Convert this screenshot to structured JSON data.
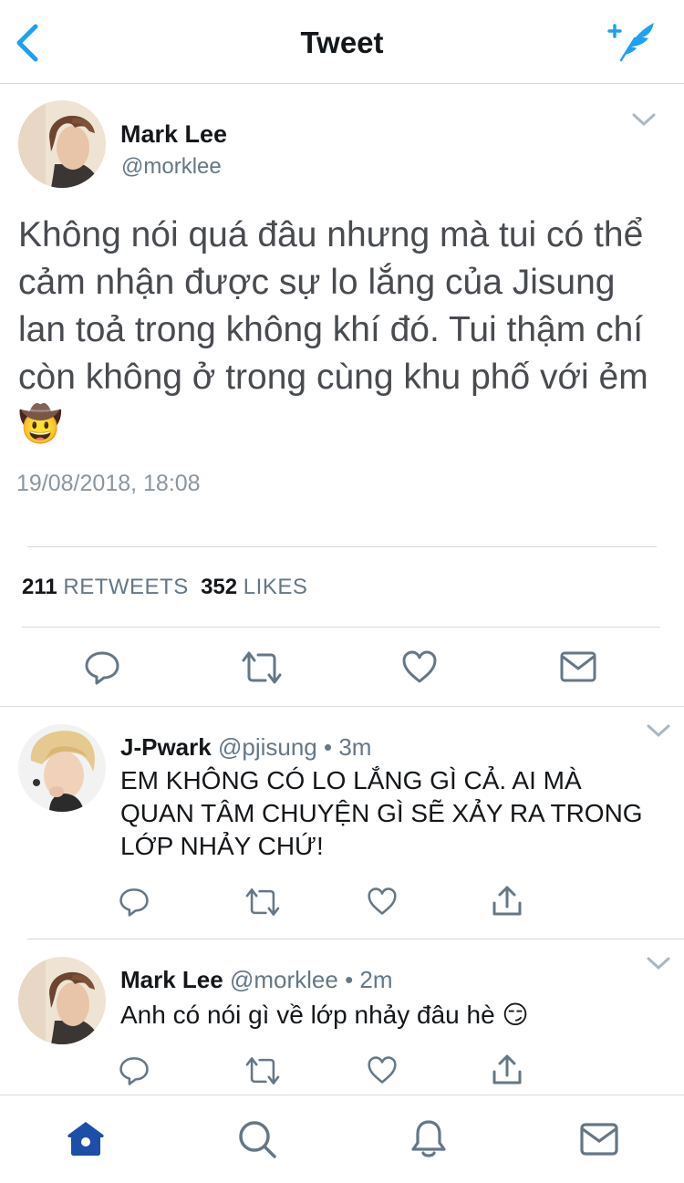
{
  "nav": {
    "title": "Tweet",
    "back_icon": "chevron-left-icon",
    "compose_icon": "compose-feather-icon"
  },
  "colors": {
    "accent": "#1da1f2",
    "muted": "#657786",
    "text": "#14171a",
    "divider": "#d6d9dc"
  },
  "main_tweet": {
    "name": "Mark Lee",
    "handle": "@morklee",
    "text": "Không nói quá đâu nhưng mà tui có thể cảm nhận được sự lo lắng của Jisung lan toả trong không khí đó. Tui thậm chí còn không ở trong cùng khu phố với ẻm 🤠",
    "timestamp": "19/08/2018, 18:08",
    "retweets_count": "211",
    "retweets_label": "RETWEETS",
    "likes_count": "352",
    "likes_label": "LIKES"
  },
  "replies": [
    {
      "name": "J-Pwark",
      "handle": "@pjisung",
      "time": "• 3m",
      "text": "EM KHÔNG CÓ LO LẮNG GÌ CẢ. AI MÀ QUAN TÂM CHUYỆN GÌ SẼ XẢY RA TRONG LỚP NHẢY CHỨ!"
    },
    {
      "name": "Mark Lee",
      "handle": "@morklee",
      "time": "• 2m",
      "text": "Anh có nói gì về lớp nhảy đâu hè 😏"
    }
  ],
  "tabbar": {
    "items": [
      "home-icon",
      "search-icon",
      "notifications-icon",
      "messages-icon"
    ],
    "active": "home-icon"
  }
}
